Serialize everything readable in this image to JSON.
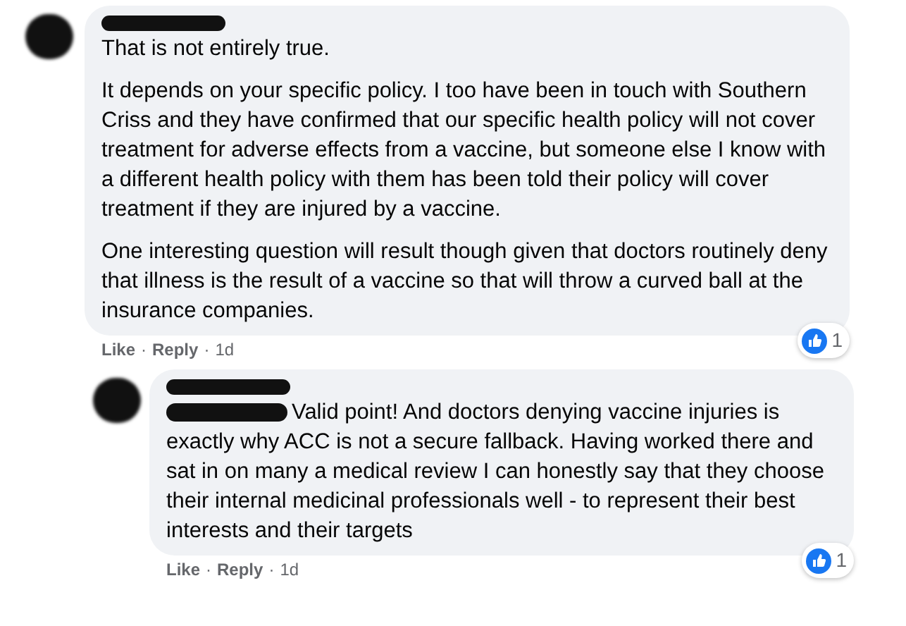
{
  "comments": [
    {
      "paragraphs": [
        "That is not entirely true.",
        "It depends on your specific policy. I too have been in touch with Southern Criss and they have confirmed that our specific health policy will not cover treatment for adverse effects from a vaccine, but someone else I know with a different health policy with them has been told their policy will cover treatment if they are injured by a vaccine.",
        "One interesting question will result though given that doctors routinely deny that illness is the result of a vaccine so that will throw a curved ball at the insurance companies."
      ],
      "reaction_count": "1",
      "footer": [
        {
          "kind": "link",
          "text": "Like"
        },
        {
          "kind": "separator",
          "text": "·"
        },
        {
          "kind": "link",
          "text": "Reply"
        },
        {
          "kind": "separator",
          "text": "·"
        },
        {
          "kind": "time",
          "text": "1d"
        }
      ]
    },
    {
      "paragraphs": [
        "Valid point! And doctors denying vaccine injuries is exactly why ACC is not a secure fallback. Having worked there and sat in on many a medical review I can honestly say that they choose their internal medicinal professionals well - to represent their best interests and their targets"
      ],
      "reaction_count": "1",
      "footer": [
        {
          "kind": "link",
          "text": "Like"
        },
        {
          "kind": "separator",
          "text": "·"
        },
        {
          "kind": "link",
          "text": "Reply"
        },
        {
          "kind": "separator",
          "text": "·"
        },
        {
          "kind": "time",
          "text": "1d"
        }
      ]
    }
  ]
}
